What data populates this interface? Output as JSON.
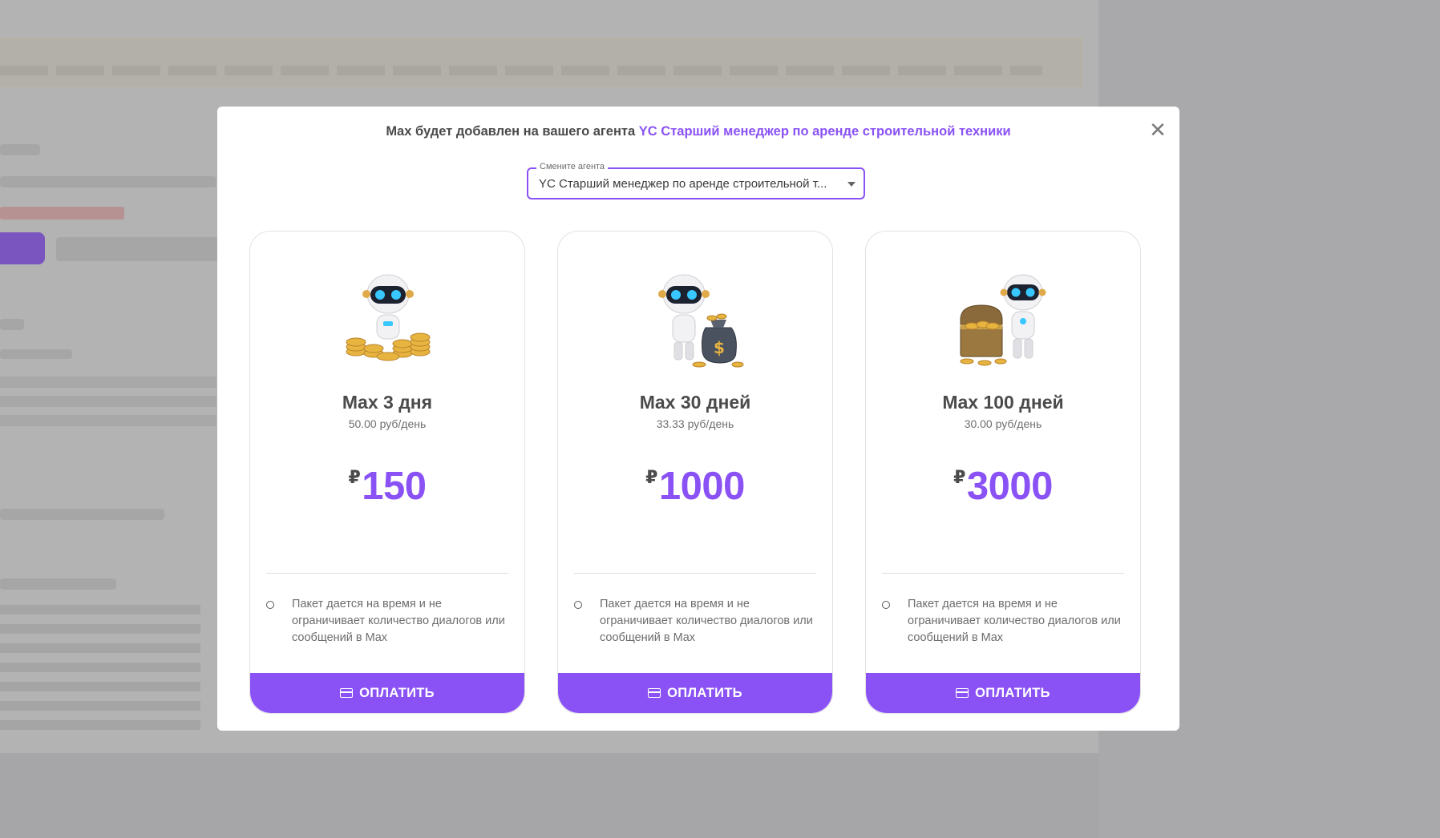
{
  "modal": {
    "header_prefix": "Max будет добавлен на вашего агента ",
    "header_agent": "YC Старший менеджер по аренде строительной техники",
    "close_label": "✕"
  },
  "agent_select": {
    "label": "Смените агента",
    "value": "YC Старший менеджер по аренде строительной т..."
  },
  "plans": [
    {
      "name": "Max 3 дня",
      "rate": "50.00 руб/день",
      "currency": "₽",
      "price": "150",
      "feature": "Пакет дается на время и не ограничивает количество диалогов или сообщений в Max",
      "button": "ОПЛАТИТЬ",
      "image": "robot-with-coins"
    },
    {
      "name": "Max 30 дней",
      "rate": "33.33 руб/день",
      "currency": "₽",
      "price": "1000",
      "feature": "Пакет дается на время и не ограничивает количество диалогов или сообщений в Max",
      "button": "ОПЛАТИТЬ",
      "image": "robot-with-money-bag"
    },
    {
      "name": "Max 100 дней",
      "rate": "30.00 руб/день",
      "currency": "₽",
      "price": "3000",
      "feature": "Пакет дается на время и не ограничивает количество диалогов или сообщений в Max",
      "button": "ОПЛАТИТЬ",
      "image": "robot-with-treasure-chest"
    }
  ],
  "colors": {
    "accent": "#8a52f5",
    "overlay": "#a6a6a8"
  }
}
